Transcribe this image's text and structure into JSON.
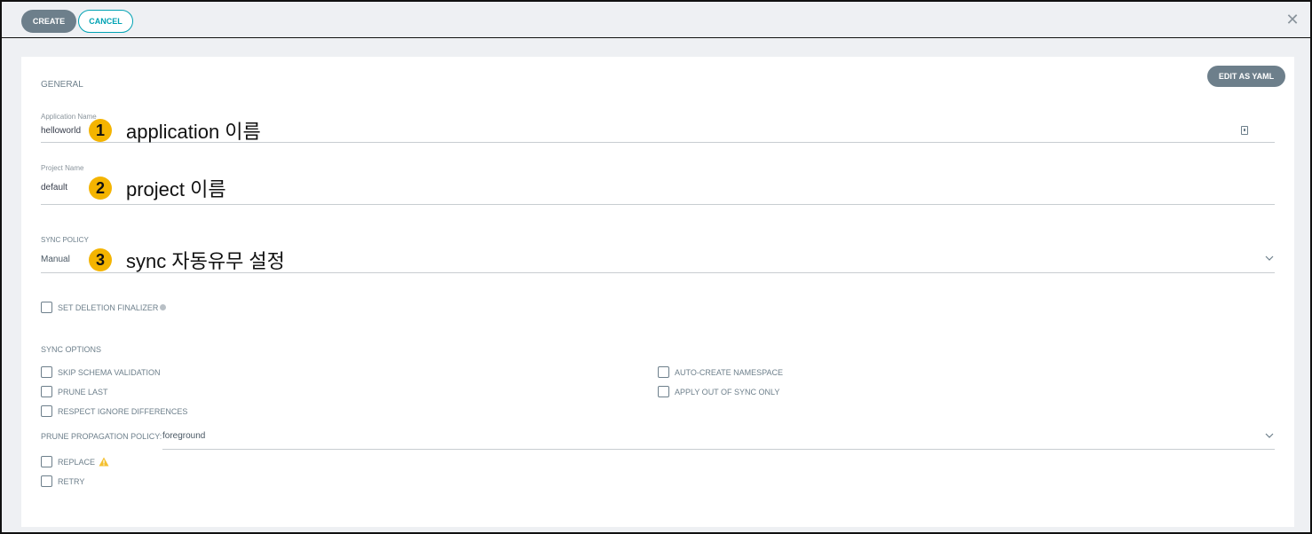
{
  "toolbar": {
    "create_label": "CREATE",
    "cancel_label": "CANCEL",
    "close_glyph": "✕"
  },
  "general": {
    "section_title": "GENERAL",
    "edit_yaml_label": "EDIT AS YAML",
    "application_name": {
      "label": "Application Name",
      "value": "helloworld"
    },
    "project_name": {
      "label": "Project Name",
      "value": "default"
    },
    "sync_policy": {
      "label": "SYNC POLICY",
      "value": "Manual"
    },
    "set_deletion_finalizer": "SET DELETION FINALIZER"
  },
  "annotations": [
    {
      "number": "1",
      "text": "application 이름"
    },
    {
      "number": "2",
      "text": "project 이름"
    },
    {
      "number": "3",
      "text": "sync 자동유무 설정"
    }
  ],
  "sync_options": {
    "title": "SYNC OPTIONS",
    "left": [
      "SKIP SCHEMA VALIDATION",
      "PRUNE LAST",
      "RESPECT IGNORE DIFFERENCES"
    ],
    "right": [
      "AUTO-CREATE NAMESPACE",
      "APPLY OUT OF SYNC ONLY"
    ],
    "prune_propagation": {
      "label": "PRUNE PROPAGATION POLICY:",
      "value": "foreground"
    },
    "replace": "REPLACE",
    "retry": "RETRY"
  },
  "colors": {
    "accent": "#00a2b3",
    "button_gray": "#6d7f8b",
    "badge": "#f4b400",
    "warning": "#f4c030"
  }
}
